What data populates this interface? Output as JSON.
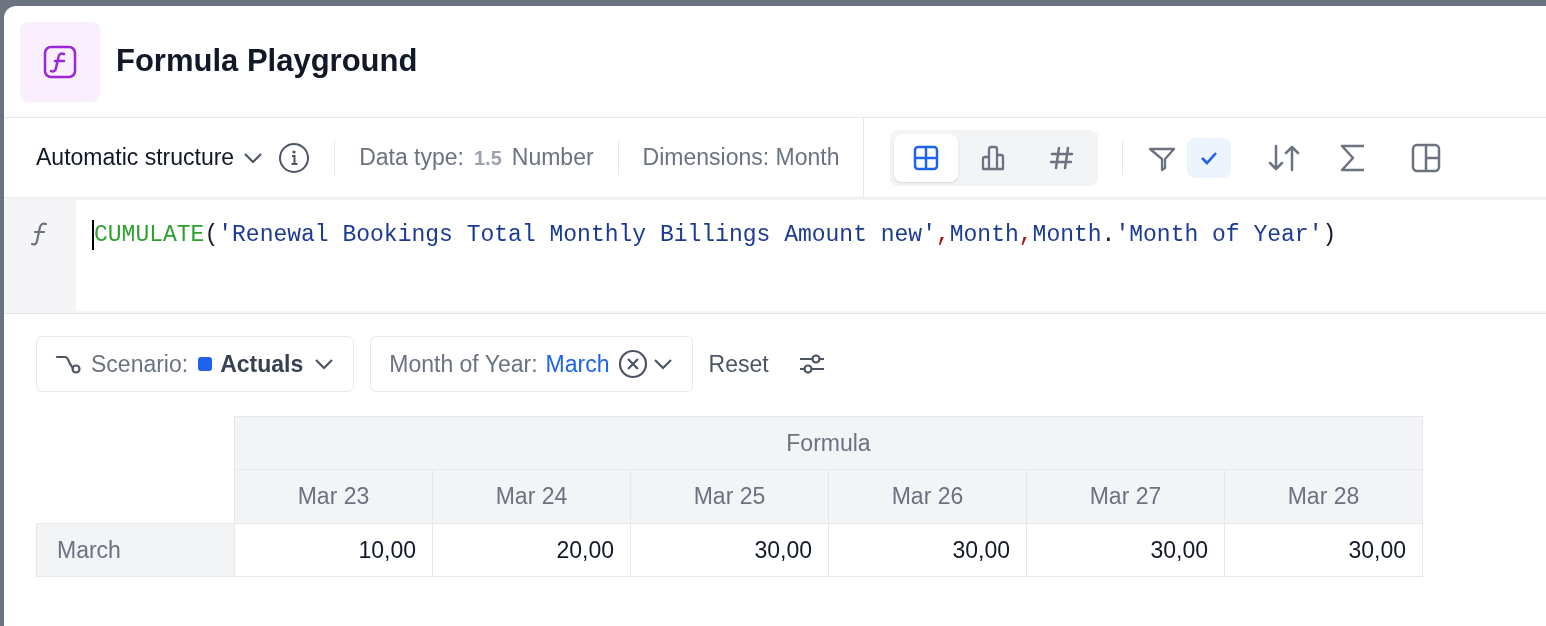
{
  "window": {
    "title": "Formula Playground"
  },
  "toolbar": {
    "structure": "Automatic structure",
    "data_type_label": "Data type:",
    "data_type_badge": "1.5",
    "data_type": "Number",
    "dimensions": "Dimensions: Month",
    "views": [
      {
        "kind": "table",
        "selected": true
      },
      {
        "kind": "chart",
        "selected": false
      },
      {
        "kind": "number",
        "selected": false
      }
    ],
    "filter_checked": true
  },
  "formula": {
    "tokens": [
      {
        "kind": "function",
        "text": "CUMULATE"
      },
      {
        "kind": "paren",
        "text": "("
      },
      {
        "kind": "string",
        "text": "'Renewal Bookings Total Monthly Billings Amount new'"
      },
      {
        "kind": "separator",
        "text": ","
      },
      {
        "kind": "identifier",
        "text": "Month"
      },
      {
        "kind": "separator",
        "text": ","
      },
      {
        "kind": "identifier",
        "text": "Month"
      },
      {
        "kind": "paren",
        "text": "."
      },
      {
        "kind": "string",
        "text": "'Month of Year'"
      },
      {
        "kind": "paren",
        "text": ")"
      }
    ]
  },
  "filters": {
    "scenario_label": "Scenario:",
    "scenario": {
      "value": "Actuals",
      "color": "#1d63ed"
    },
    "month_label": "Month of Year:",
    "month_value": "March",
    "reset": "Reset"
  },
  "table": {
    "group_header": "Formula",
    "columns": [
      "Mar 23",
      "Mar 24",
      "Mar 25",
      "Mar 26",
      "Mar 27",
      "Mar 28"
    ],
    "rows": [
      {
        "label": "March",
        "values": [
          "10,00",
          "20,00",
          "30,00",
          "30,00",
          "30,00",
          "30,00"
        ]
      }
    ]
  }
}
